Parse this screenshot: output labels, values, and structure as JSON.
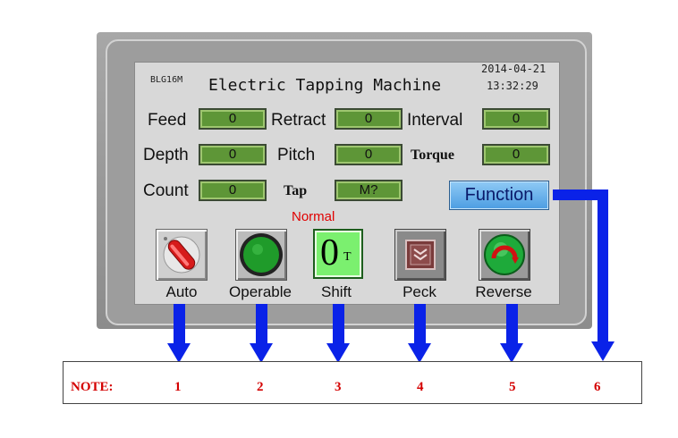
{
  "header": {
    "model": "BLG16M",
    "title": "Electric Tapping Machine",
    "date": "2014-04-21",
    "time": "13:32:29"
  },
  "params": {
    "feed": {
      "label": "Feed",
      "value": "0"
    },
    "retract": {
      "label": "Retract",
      "value": "0"
    },
    "interval": {
      "label": "Interval",
      "value": "0"
    },
    "depth": {
      "label": "Depth",
      "value": "0"
    },
    "pitch": {
      "label": "Pitch",
      "value": "0"
    },
    "torque": {
      "label": "Torque",
      "value": "0"
    },
    "count": {
      "label": "Count",
      "value": "0"
    },
    "tap": {
      "label": "Tap",
      "value": "M?"
    }
  },
  "function_button": "Function",
  "status_text": "Normal",
  "status_color": "#e00000",
  "buttons": {
    "auto": "Auto",
    "operable": "Operable",
    "shift": "Shift",
    "shift_glyph": "0",
    "shift_sub": "T",
    "peck": "Peck",
    "reverse": "Reverse"
  },
  "note": {
    "label": "NOTE:",
    "numbers": [
      "1",
      "2",
      "3",
      "4",
      "5",
      "6"
    ]
  },
  "colors": {
    "arrow": "#0a22e8",
    "value_field": "#5e9637",
    "function_button": "#5aa8e8"
  },
  "icons": [
    "selector-switch-icon",
    "green-indicator-icon",
    "shift-toggle-icon",
    "peck-icon",
    "reverse-icon"
  ]
}
